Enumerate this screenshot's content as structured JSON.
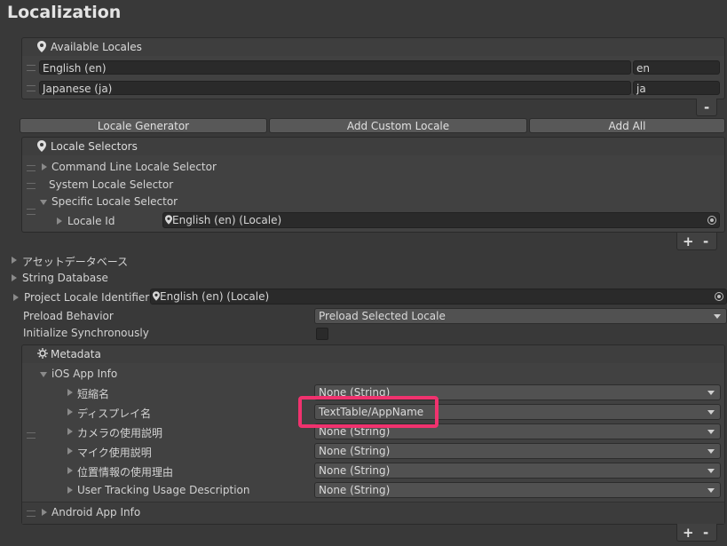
{
  "title": "Localization",
  "available_locales": {
    "header": "Available Locales",
    "rows": [
      {
        "name": "English (en)",
        "code": "en"
      },
      {
        "name": "Japanese (ja)",
        "code": "ja"
      }
    ],
    "minus": "-"
  },
  "buttons": {
    "locale_generator": "Locale Generator",
    "add_custom_locale": "Add Custom Locale",
    "add_all": "Add All"
  },
  "locale_selectors": {
    "header": "Locale Selectors",
    "items": [
      "Command Line Locale Selector",
      "System Locale Selector",
      "Specific Locale Selector"
    ],
    "locale_id_label": "Locale Id",
    "locale_id_value": "English (en) (Locale)",
    "plus": "+",
    "minus": "-"
  },
  "sections": {
    "asset_database": "アセットデータベース",
    "string_database": "String Database",
    "project_locale_label": "Project Locale Identifier",
    "project_locale_value": "English (en) (Locale)",
    "preload_label": "Preload Behavior",
    "preload_value": "Preload Selected Locale",
    "init_sync_label": "Initialize Synchronously"
  },
  "metadata": {
    "header": "Metadata",
    "ios_header": "iOS App Info",
    "rows": [
      {
        "label": "短縮名",
        "value": "None (String)"
      },
      {
        "label": "ディスプレイ名",
        "value": "TextTable/AppName"
      },
      {
        "label": "カメラの使用説明",
        "value": "None (String)"
      },
      {
        "label": "マイク使用説明",
        "value": "None (String)"
      },
      {
        "label": "位置情報の使用理由",
        "value": "None (String)"
      },
      {
        "label": "User Tracking Usage Description",
        "value": "None (String)"
      }
    ],
    "android_header": "Android App Info",
    "plus": "+",
    "minus": "-"
  },
  "colors": {
    "background": "#393939",
    "highlight": "#f0326e"
  }
}
